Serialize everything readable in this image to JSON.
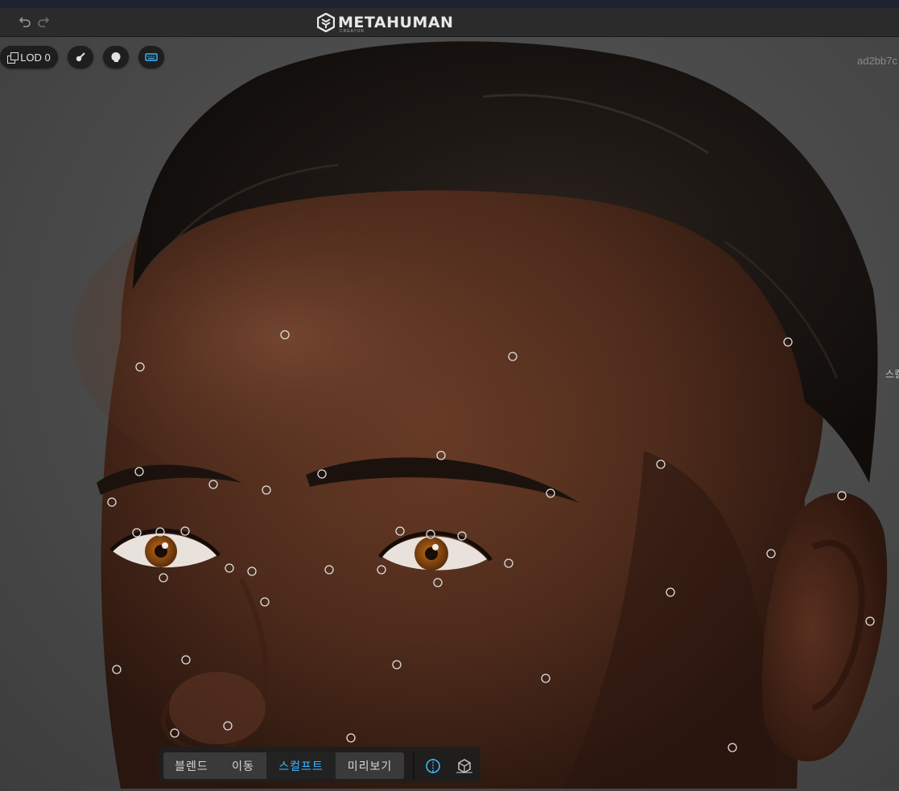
{
  "titlebar": {
    "undo_icon": "undo-icon",
    "redo_icon": "redo-icon",
    "logo_text": "METAHUMAN",
    "logo_sub": "CREATOR"
  },
  "viewport": {
    "lod_label": "LOD 0",
    "id_text": "ad2bb7c",
    "side_text": "스컬"
  },
  "toolbar": {
    "tabs": [
      "블렌드",
      "이동",
      "스컬프트",
      "미리보기"
    ],
    "active_tab": "스컬프트",
    "tools": [
      "symmetry-tool-icon",
      "gizmo-tool-icon"
    ]
  },
  "colors": {
    "accent": "#3fb6ff",
    "skin": "#5a3322",
    "hair": "#1a1512",
    "iris": "#8a4a12"
  }
}
